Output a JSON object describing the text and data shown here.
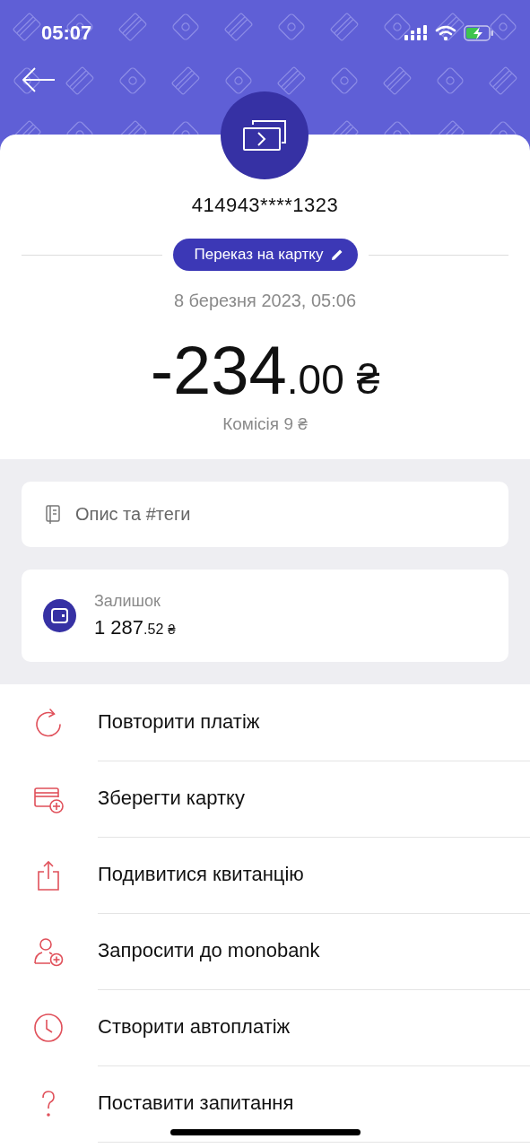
{
  "status_bar": {
    "time": "05:07"
  },
  "transfer": {
    "card_number": "414943****1323",
    "category": "Переказ на картку",
    "date": "8 березня 2023, 05:06",
    "amount": {
      "whole": "-234",
      "fraction": ".00",
      "currency": "₴"
    },
    "fee": "Комісія 9 ₴"
  },
  "description": {
    "placeholder": "Опис та #теги"
  },
  "balance": {
    "label": "Залишок",
    "whole": "1 287",
    "fraction": ".52",
    "currency": "₴"
  },
  "actions": [
    {
      "kind": "repeat",
      "label": "Повторити платіж"
    },
    {
      "kind": "save-card",
      "label": "Зберегти картку"
    },
    {
      "kind": "share",
      "label": "Подивитися квитанцію"
    },
    {
      "kind": "invite",
      "label": "Запросити до monobank"
    },
    {
      "kind": "clock",
      "label": "Створити автоплатіж"
    },
    {
      "kind": "question",
      "label": "Поставити запитання"
    }
  ]
}
